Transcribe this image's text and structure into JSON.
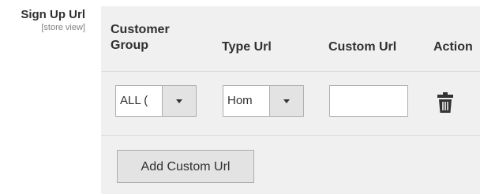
{
  "field": {
    "label": "Sign Up Url",
    "scope": "[store view]"
  },
  "table": {
    "headers": {
      "customer_group": "Customer Group",
      "type_url": "Type Url",
      "custom_url": "Custom Url",
      "action": "Action"
    },
    "rows": [
      {
        "customer_group": "ALL (",
        "type_url": "Hom",
        "custom_url": "",
        "action_icon": "trash-icon"
      }
    ]
  },
  "add_button_label": "Add Custom Url",
  "colors": {
    "panel_background": "#f0f0f0",
    "border": "#adadad",
    "button_background": "#e3e3e3",
    "text": "#303030",
    "scope_text": "#808080"
  }
}
